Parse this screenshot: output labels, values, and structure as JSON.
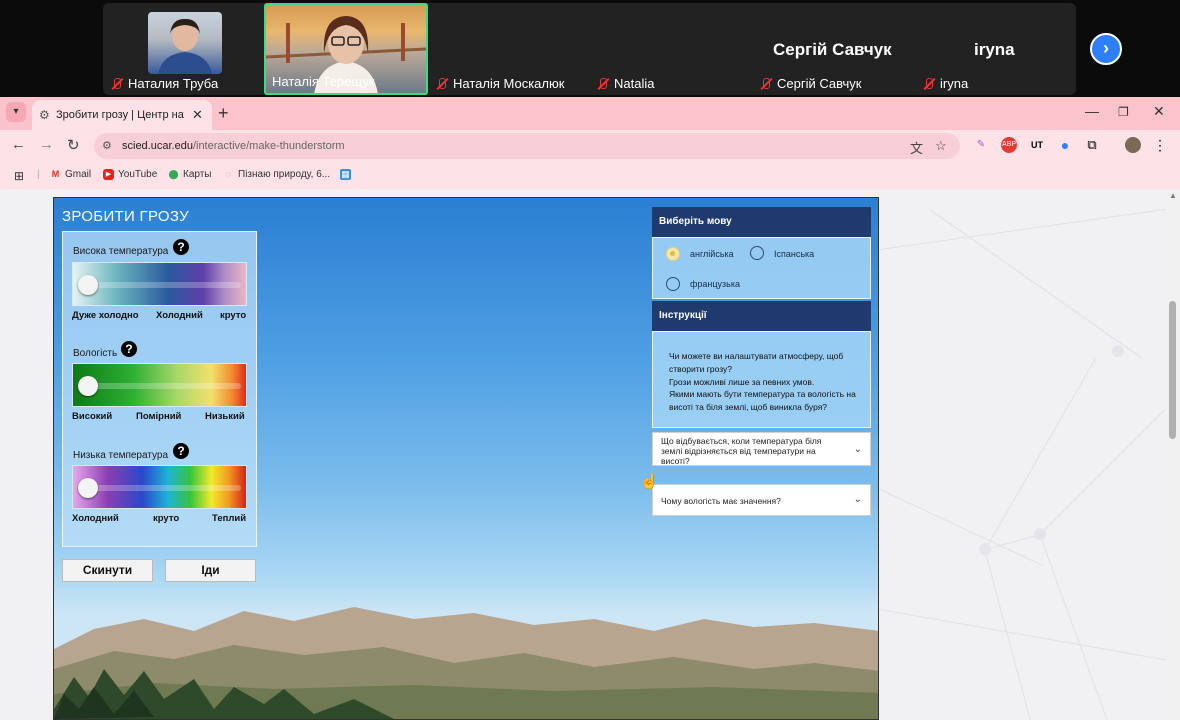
{
  "call": {
    "participants": [
      {
        "name": "Наталия Труба"
      },
      {
        "name": "Наталія Терещук"
      },
      {
        "name": "Наталія Москалюк"
      },
      {
        "name": "Natalia"
      },
      {
        "name": "Сергій Савчук"
      },
      {
        "name": "iryna"
      }
    ],
    "big_names": [
      "Сергій Савчук",
      "iryna"
    ],
    "next_icon": "chevron-right-icon"
  },
  "browser": {
    "tab_title": "Зробити грозу | Центр науков",
    "url_domain": "scied.ucar.edu",
    "url_path": "/interactive/make-thunderstorm",
    "bookmarks": [
      "Gmail",
      "YouTube",
      "Карты",
      "Пізнаю природу, 6..."
    ]
  },
  "sim": {
    "title": "ЗРОБИТИ ГРОЗУ",
    "sliders": [
      {
        "label": "Висока температура",
        "scale": [
          "Дуже холодно",
          "Холодний",
          "круто"
        ],
        "value": 0
      },
      {
        "label": "Вологість",
        "scale": [
          "Високий",
          "Помірний",
          "Низький"
        ],
        "value": 0
      },
      {
        "label": "Низька температура",
        "scale": [
          "Холодний",
          "круто",
          "Теплий"
        ],
        "value": 0
      }
    ],
    "reset_label": "Скинути",
    "go_label": "Іди",
    "language": {
      "header": "Виберіть мову",
      "options": [
        "англійська",
        "Іспанська",
        "французька"
      ],
      "selected": "англійська"
    },
    "instructions": {
      "header": "Інструкції",
      "lines": [
        "Чи можете ви налаштувати атмосферу, щоб створити грозу?",
        "Грози можливі лише за певних умов.",
        "Якими мають бути температура та вологість на висоті та біля землі, щоб виникла буря?"
      ]
    },
    "accordions": [
      "Що відбувається, коли температура біля землі відрізняється від температури на висоті?",
      "Чому вологість має значення?"
    ]
  },
  "colors": {
    "accent": "#1f3a6e",
    "chrome": "#fbc3cc",
    "active_speaker": "#3ddc84"
  }
}
